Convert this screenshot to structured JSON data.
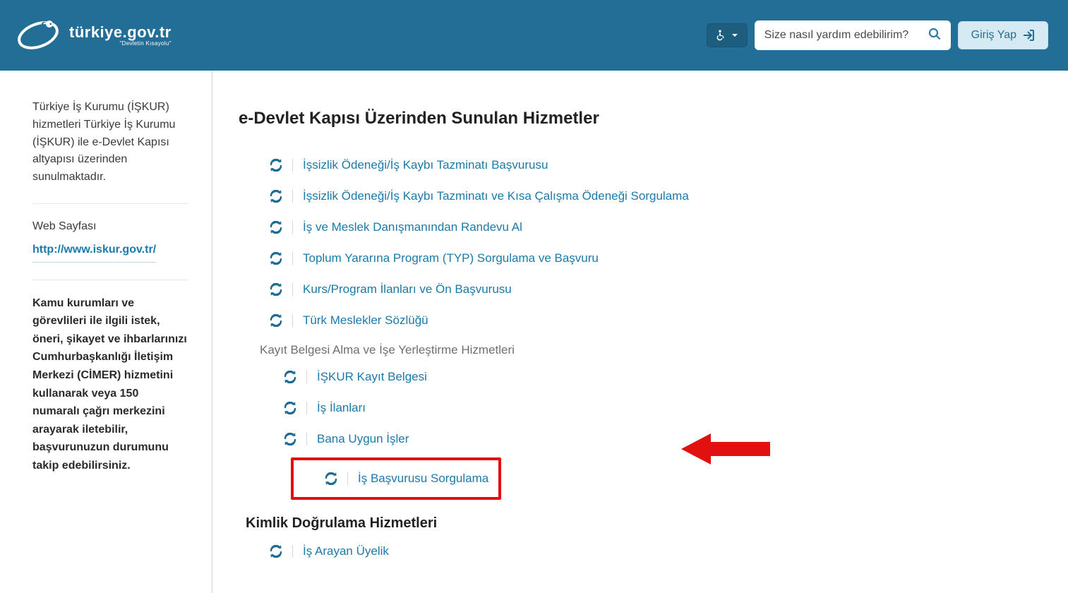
{
  "header": {
    "site_name": "türkiye.gov.tr",
    "tagline": "\"Devletin Kısayolu\"",
    "search_placeholder": "Size nasıl yardım edebilirim?",
    "login_label": "Giriş Yap"
  },
  "sidebar": {
    "intro": "Türkiye İş Kurumu (İŞKUR) hizmetleri Türkiye İş Kurumu (İŞKUR) ile e-Devlet Kapısı altyapısı üzerinden sunulmaktadır.",
    "web_label": "Web Sayfası",
    "web_url": "http://www.iskur.gov.tr/",
    "notice": "Kamu kurumları ve görevlileri ile ilgili istek, öneri, şikayet ve ihbarlarınızı Cumhurbaşkanlığı İletişim Merkezi (CİMER) hizmetini kullanarak veya 150 numaralı çağrı merkezini arayarak iletebilir, başvurunuzun durumunu takip edebilirsiniz."
  },
  "main": {
    "title": "e-Devlet Kapısı Üzerinden Sunulan Hizmetler",
    "services_top": [
      "İşsizlik Ödeneği/İş Kaybı Tazminatı Başvurusu",
      "İşsizlik Ödeneği/İş Kaybı Tazminatı ve Kısa Çalışma Ödeneği Sorgulama",
      "İş ve Meslek Danışmanından Randevu Al",
      "Toplum Yararına Program (TYP) Sorgulama ve Başvuru",
      "Kurs/Program İlanları ve Ön Başvurusu",
      "Türk Meslekler Sözlüğü"
    ],
    "sub1_title": "Kayıt Belgesi Alma ve İşe Yerleştirme Hizmetleri",
    "sub1_items": [
      "İŞKUR Kayıt Belgesi",
      "İş İlanları",
      "Bana Uygun İşler",
      "İş Başvurusu Sorgulama"
    ],
    "sub2_title": "Kimlik Doğrulama Hizmetleri",
    "sub2_items": [
      "İş Arayan Üyelik"
    ]
  }
}
